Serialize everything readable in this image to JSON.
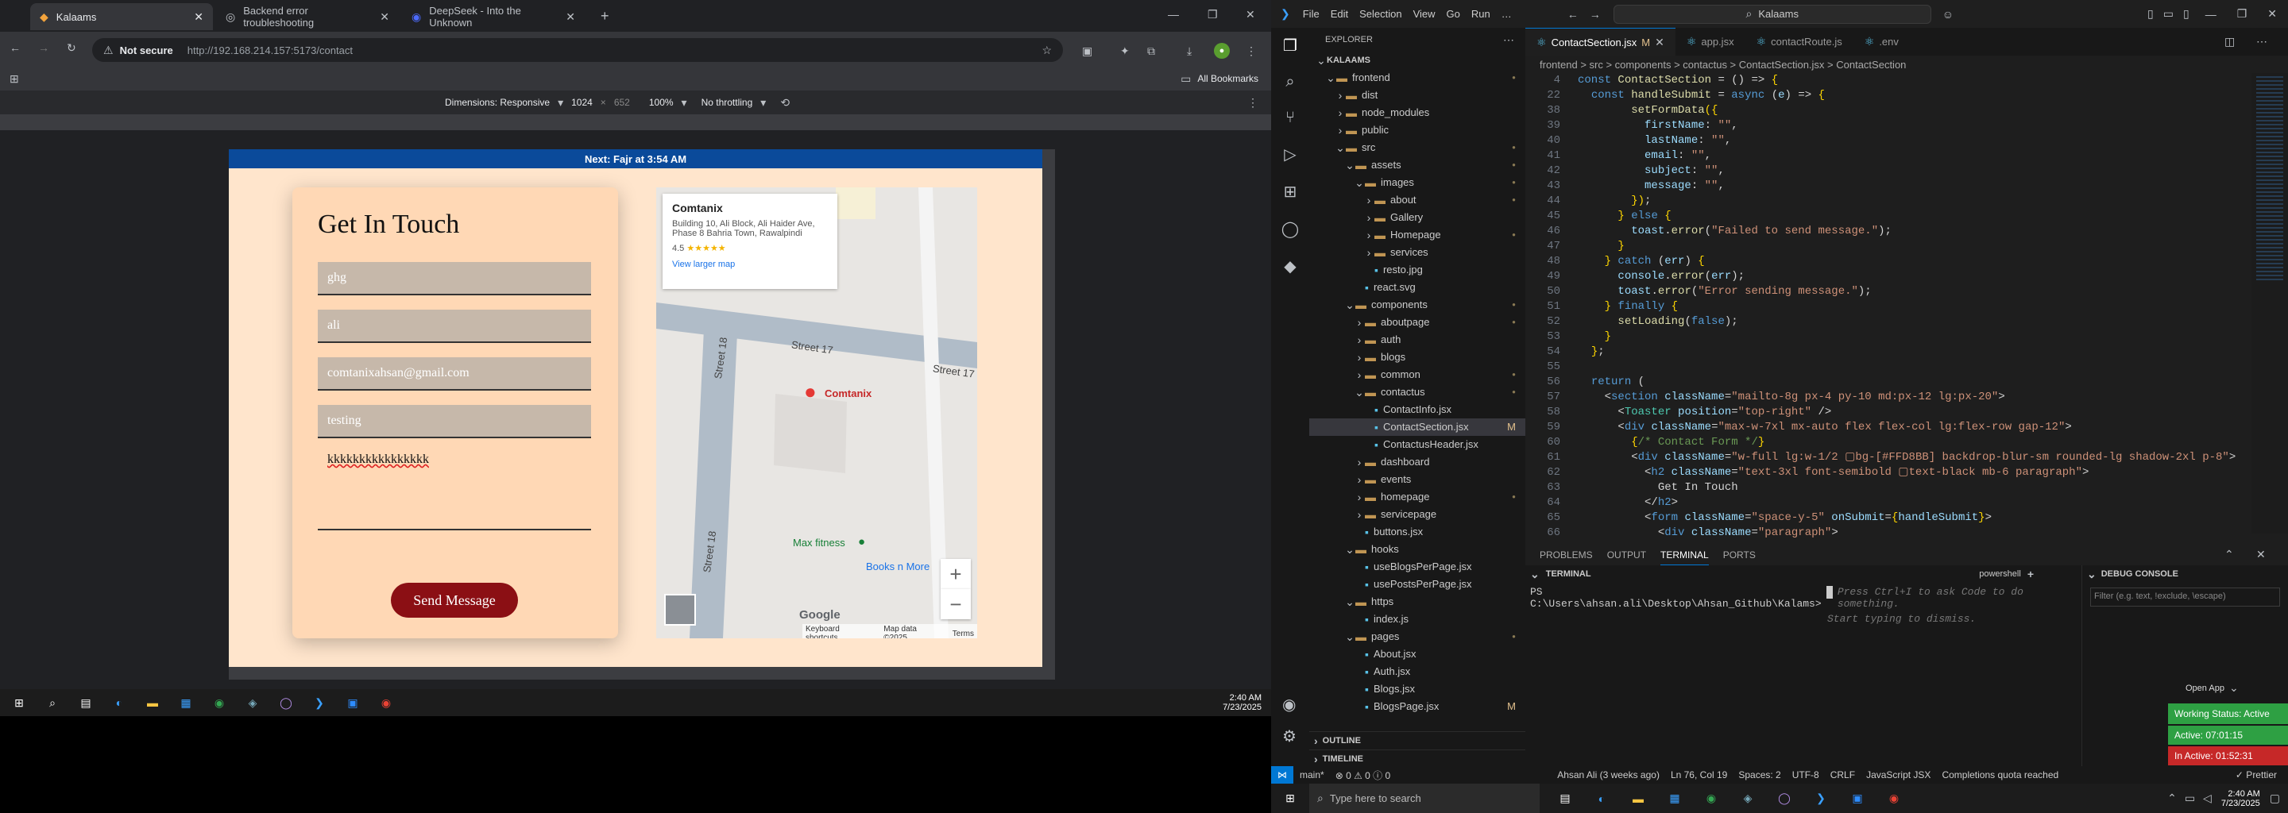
{
  "browser": {
    "tabs": [
      {
        "label": "Kalaams",
        "active": true
      },
      {
        "label": "Backend error troubleshooting",
        "active": false
      },
      {
        "label": "DeepSeek - Into the Unknown",
        "active": false
      }
    ],
    "security": "Not secure",
    "url": "http://192.168.214.157:5173/contact",
    "all_bookmarks": "All Bookmarks",
    "devtools": {
      "dimensions_label": "Dimensions: Responsive",
      "width": "1024",
      "times": "×",
      "height": "652",
      "zoom": "100%",
      "throttle": "No throttling"
    }
  },
  "site": {
    "banner": "Next: Fajr at 3:54 AM",
    "heading": "Get In Touch",
    "fields": [
      {
        "value": "ghg"
      },
      {
        "value": "ali"
      },
      {
        "value": "comtanixahsan@gmail.com"
      },
      {
        "value": "testing"
      }
    ],
    "message": "kkkkkkkkkkkkkkkk",
    "send": "Send Message",
    "map": {
      "place": "Comtanix",
      "address": "Building 10, Ali Block, Ali Haider Ave, Phase 8 Bahria Town, Rawalpindi",
      "rating": "4.5",
      "stars": "★★★★★",
      "view": "View larger map",
      "street17": "Street 17",
      "street18": "Street 18",
      "pin_label": "Comtanix",
      "poi1": "Max fitness",
      "poi2": "Books n More",
      "google": "Google",
      "footer": [
        "Keyboard shortcuts",
        "Map data ©2025",
        "Terms"
      ]
    }
  },
  "taskbar_left": {
    "time": "2:40 AM",
    "date": "7/23/2025"
  },
  "vscode": {
    "menu": [
      "File",
      "Edit",
      "Selection",
      "View",
      "Go",
      "Run",
      "…"
    ],
    "search": "Kalaams",
    "explorer_title": "EXPLORER",
    "tree": [
      {
        "label": "KALAAMS",
        "d": 0,
        "t": "root"
      },
      {
        "label": "frontend",
        "d": 1,
        "t": "open",
        "m": "dot"
      },
      {
        "label": "dist",
        "d": 2,
        "t": "closed"
      },
      {
        "label": "node_modules",
        "d": 2,
        "t": "closed"
      },
      {
        "label": "public",
        "d": 2,
        "t": "closed"
      },
      {
        "label": "src",
        "d": 2,
        "t": "open",
        "m": "dot"
      },
      {
        "label": "assets",
        "d": 3,
        "t": "open",
        "m": "dot"
      },
      {
        "label": "images",
        "d": 4,
        "t": "open",
        "m": "dot"
      },
      {
        "label": "about",
        "d": 5,
        "t": "closed",
        "m": "dot"
      },
      {
        "label": "Gallery",
        "d": 5,
        "t": "closed"
      },
      {
        "label": "Homepage",
        "d": 5,
        "t": "closed",
        "m": "dot"
      },
      {
        "label": "services",
        "d": 5,
        "t": "closed"
      },
      {
        "label": "resto.jpg",
        "d": 5,
        "t": "file"
      },
      {
        "label": "react.svg",
        "d": 4,
        "t": "file"
      },
      {
        "label": "components",
        "d": 3,
        "t": "open",
        "m": "dot"
      },
      {
        "label": "aboutpage",
        "d": 4,
        "t": "closed",
        "m": "dot"
      },
      {
        "label": "auth",
        "d": 4,
        "t": "closed"
      },
      {
        "label": "blogs",
        "d": 4,
        "t": "closed"
      },
      {
        "label": "common",
        "d": 4,
        "t": "closed",
        "m": "dot"
      },
      {
        "label": "contactus",
        "d": 4,
        "t": "open",
        "m": "dot"
      },
      {
        "label": "ContactInfo.jsx",
        "d": 5,
        "t": "file"
      },
      {
        "label": "ContactSection.jsx",
        "d": 5,
        "t": "file",
        "m": "M",
        "sel": true
      },
      {
        "label": "ContactusHeader.jsx",
        "d": 5,
        "t": "file"
      },
      {
        "label": "dashboard",
        "d": 4,
        "t": "closed"
      },
      {
        "label": "events",
        "d": 4,
        "t": "closed"
      },
      {
        "label": "homepage",
        "d": 4,
        "t": "closed",
        "m": "dot"
      },
      {
        "label": "servicepage",
        "d": 4,
        "t": "closed"
      },
      {
        "label": "buttons.jsx",
        "d": 4,
        "t": "file"
      },
      {
        "label": "hooks",
        "d": 3,
        "t": "open"
      },
      {
        "label": "useBlogsPerPage.jsx",
        "d": 4,
        "t": "file"
      },
      {
        "label": "usePostsPerPage.jsx",
        "d": 4,
        "t": "file"
      },
      {
        "label": "https",
        "d": 3,
        "t": "open"
      },
      {
        "label": "index.js",
        "d": 4,
        "t": "file"
      },
      {
        "label": "pages",
        "d": 3,
        "t": "open",
        "m": "dot"
      },
      {
        "label": "About.jsx",
        "d": 4,
        "t": "file"
      },
      {
        "label": "Auth.jsx",
        "d": 4,
        "t": "file"
      },
      {
        "label": "Blogs.jsx",
        "d": 4,
        "t": "file"
      },
      {
        "label": "BlogsPage.jsx",
        "d": 4,
        "t": "file",
        "m": "M"
      }
    ],
    "outline": "OUTLINE",
    "timeline": "TIMELINE",
    "editor_tabs": [
      {
        "label": "ContactSection.jsx",
        "flag": "M",
        "active": true
      },
      {
        "label": "app.jsx",
        "active": false
      },
      {
        "label": "contactRoute.js",
        "active": false
      },
      {
        "label": ".env",
        "active": false
      }
    ],
    "breadcrumb": "frontend  >  src  >  components  >  contactus  >  ContactSection.jsx  >  ContactSection",
    "code": [
      {
        "n": "4",
        "h": "<span class='kw'>const</span> <span class='fn'>ContactSection</span> <span class='pl'>= () =></span> <span class='br'>{</span>"
      },
      {
        "n": "22",
        "h": "  <span class='kw'>const</span> <span class='fn'>handleSubmit</span> <span class='pl'>=</span> <span class='kw'>async</span> <span class='pl'>(</span><span class='pr'>e</span><span class='pl'>) =></span> <span class='br'>{</span>"
      },
      {
        "n": "38",
        "h": "        <span class='fn'>setFormData</span><span class='br'>({</span>"
      },
      {
        "n": "39",
        "h": "          <span class='pr'>firstName</span><span class='pl'>:</span> <span class='str'>\"\"</span><span class='pl'>,</span>"
      },
      {
        "n": "40",
        "h": "          <span class='pr'>lastName</span><span class='pl'>:</span> <span class='str'>\"\"</span><span class='pl'>,</span>"
      },
      {
        "n": "41",
        "h": "          <span class='pr'>email</span><span class='pl'>:</span> <span class='str'>\"\"</span><span class='pl'>,</span>"
      },
      {
        "n": "42",
        "h": "          <span class='pr'>subject</span><span class='pl'>:</span> <span class='str'>\"\"</span><span class='pl'>,</span>"
      },
      {
        "n": "43",
        "h": "          <span class='pr'>message</span><span class='pl'>:</span> <span class='str'>\"\"</span><span class='pl'>,</span>"
      },
      {
        "n": "44",
        "h": "        <span class='br'>})</span><span class='pl'>;</span>"
      },
      {
        "n": "45",
        "h": "      <span class='br'>}</span> <span class='kw'>else</span> <span class='br'>{</span>"
      },
      {
        "n": "46",
        "h": "        <span class='pr'>toast</span><span class='pl'>.</span><span class='fn'>error</span><span class='pl'>(</span><span class='str'>\"Failed to send message.\"</span><span class='pl'>);</span>"
      },
      {
        "n": "47",
        "h": "      <span class='br'>}</span>"
      },
      {
        "n": "48",
        "h": "    <span class='br'>}</span> <span class='kw'>catch</span> <span class='pl'>(</span><span class='pr'>err</span><span class='pl'>)</span> <span class='br'>{</span>"
      },
      {
        "n": "49",
        "h": "      <span class='pr'>console</span><span class='pl'>.</span><span class='fn'>error</span><span class='pl'>(</span><span class='pr'>err</span><span class='pl'>);</span>"
      },
      {
        "n": "50",
        "h": "      <span class='pr'>toast</span><span class='pl'>.</span><span class='fn'>error</span><span class='pl'>(</span><span class='str'>\"Error sending message.\"</span><span class='pl'>);</span>"
      },
      {
        "n": "51",
        "h": "    <span class='br'>}</span> <span class='kw'>finally</span> <span class='br'>{</span>"
      },
      {
        "n": "52",
        "h": "      <span class='fn'>setLoading</span><span class='pl'>(</span><span class='kw'>false</span><span class='pl'>);</span>"
      },
      {
        "n": "53",
        "h": "    <span class='br'>}</span>"
      },
      {
        "n": "54",
        "h": "  <span class='br'>}</span><span class='pl'>;</span>"
      },
      {
        "n": "55",
        "h": ""
      },
      {
        "n": "56",
        "h": "  <span class='kw'>return</span> <span class='pl'>(</span>"
      },
      {
        "n": "57",
        "h": "    <span class='pl'>&lt;</span><span class='kw'>section</span> <span class='at'>className</span><span class='pl'>=</span><span class='str'>\"mailto-8g px-4 py-10 md:px-12 lg:px-20\"</span><span class='pl'>&gt;</span>"
      },
      {
        "n": "58",
        "h": "      <span class='pl'>&lt;</span><span class='tg'>Toaster</span> <span class='at'>position</span><span class='pl'>=</span><span class='str'>\"top-right\"</span> <span class='pl'>/&gt;</span>"
      },
      {
        "n": "59",
        "h": "      <span class='pl'>&lt;</span><span class='kw'>div</span> <span class='at'>className</span><span class='pl'>=</span><span class='str'>\"max-w-7xl mx-auto flex flex-col lg:flex-row gap-12\"</span><span class='pl'>&gt;</span>"
      },
      {
        "n": "60",
        "h": "        <span class='br'>{</span><span class='cm'>/* Contact Form */</span><span class='br'>}</span>"
      },
      {
        "n": "61",
        "h": "        <span class='pl'>&lt;</span><span class='kw'>div</span> <span class='at'>className</span><span class='pl'>=</span><span class='str'>\"w-full lg:w-1/2 ▢bg-[#FFD8BB] backdrop-blur-sm rounded-lg shadow-2xl p-8\"</span><span class='pl'>&gt;</span>"
      },
      {
        "n": "62",
        "h": "          <span class='pl'>&lt;</span><span class='kw'>h2</span> <span class='at'>className</span><span class='pl'>=</span><span class='str'>\"text-3xl font-semibold ▢text-black mb-6 paragraph\"</span><span class='pl'>&gt;</span>"
      },
      {
        "n": "63",
        "h": "            <span class='pl'>Get In Touch</span>"
      },
      {
        "n": "64",
        "h": "          <span class='pl'>&lt;/</span><span class='kw'>h2</span><span class='pl'>&gt;</span>"
      },
      {
        "n": "65",
        "h": "          <span class='pl'>&lt;</span><span class='kw'>form</span> <span class='at'>className</span><span class='pl'>=</span><span class='str'>\"space-y-5\"</span> <span class='at'>onSubmit</span><span class='pl'>=</span><span class='br'>{</span><span class='pr'>handleSubmit</span><span class='br'>}</span><span class='pl'>&gt;</span>"
      },
      {
        "n": "66",
        "h": "            <span class='pl'>&lt;</span><span class='kw'>div</span> <span class='at'>className</span><span class='pl'>=</span><span class='str'>\"paragraph\"</span><span class='pl'>&gt;</span>"
      }
    ],
    "panel_tabs": [
      "PROBLEMS",
      "OUTPUT",
      "TERMINAL",
      "PORTS"
    ],
    "terminal_header": "TERMINAL",
    "shell": "powershell",
    "prompt": "PS C:\\Users\\ahsan.ali\\Desktop\\Ahsan_Github\\Kalams>",
    "hint1": "Press Ctrl+I to ask Code to do something.",
    "hint2": "Start typing to dismiss.",
    "debug_title": "DEBUG CONSOLE",
    "debug_filter": "Filter (e.g. text, !exclude, \\escape)",
    "open_app": "Open App",
    "working": "Working Status: Active",
    "active": "Active: 07:01:15",
    "inactive": "In Active: 01:52:31",
    "status": {
      "branch": "main*",
      "errors": "⊗ 0 ⚠ 0 ⓘ 0",
      "author": "Ahsan Ali (3 weeks ago)",
      "pos": "Ln 76, Col 19",
      "spaces": "Spaces: 2",
      "enc": "UTF-8",
      "eol": "CRLF",
      "lang": "JavaScript JSX",
      "quota": "Completions quota reached",
      "prettier": "✓ Prettier"
    },
    "colors": {
      "working": "#2ea043",
      "active": "#2ea043",
      "inactive": "#c62828",
      "status_accent": "#0078d4"
    }
  },
  "taskbar_right": {
    "search": "Type here to search",
    "time": "2:40 AM",
    "date": "7/23/2025"
  }
}
